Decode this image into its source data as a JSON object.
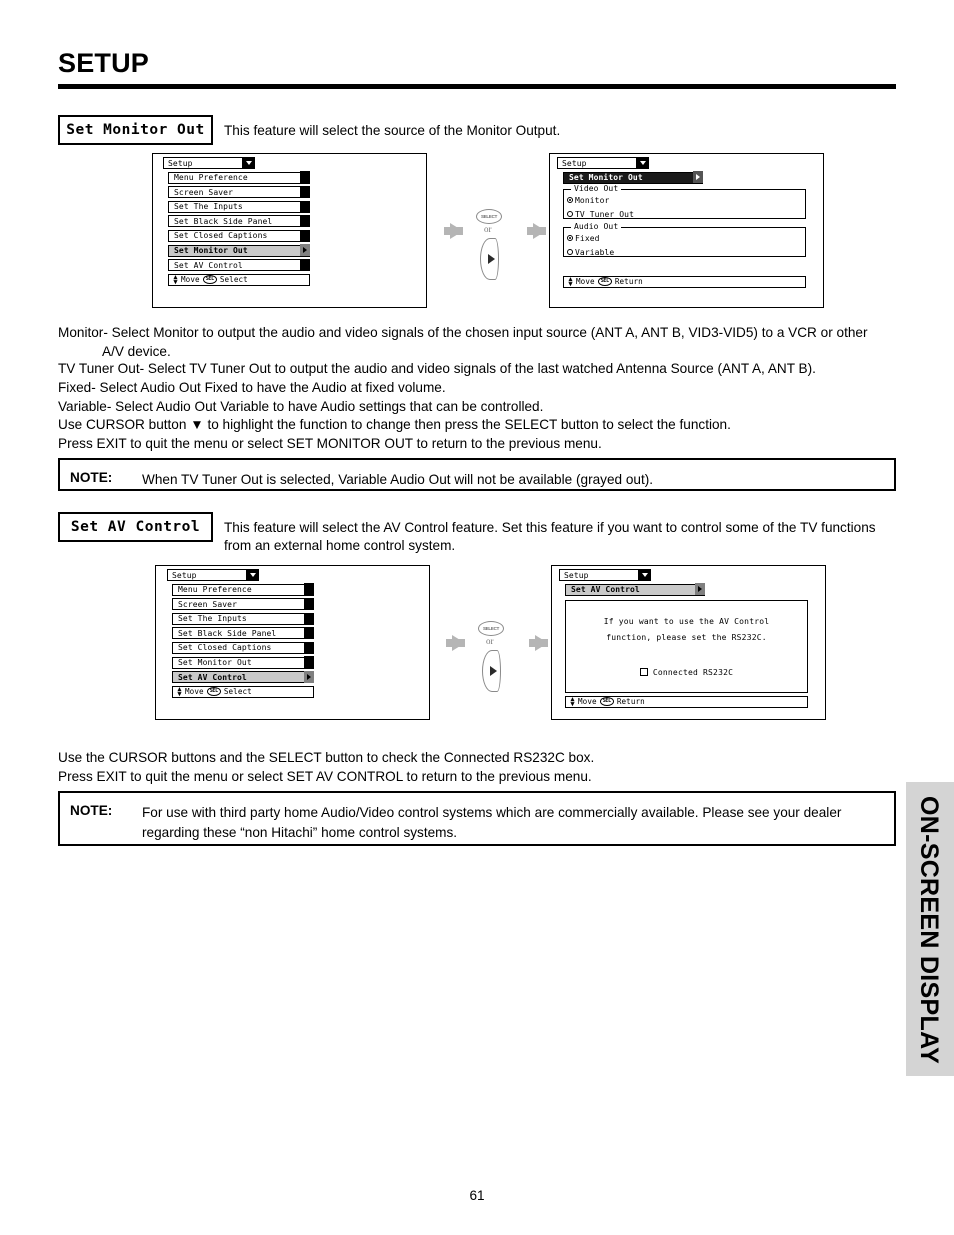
{
  "page": {
    "title": "SETUP",
    "number": "61",
    "side_tab": "ON-SCREEN DISPLAY"
  },
  "sections": [
    {
      "chip": "Set Monitor Out",
      "description": "This feature will select the source of the Monitor Output.",
      "left_menu": {
        "header": "Setup",
        "items": [
          "Menu Preference",
          "Screen Saver",
          "Set The Inputs",
          "Set Black Side Panel",
          "Set Closed Captions",
          "Set Monitor Out",
          "Set AV Control"
        ],
        "selected_index": 5,
        "footer_move": "Move",
        "footer_badge": "SEL",
        "footer_action": "Select"
      },
      "right_menu": {
        "header": "Setup",
        "title_bar": "Set Monitor Out",
        "groups": [
          {
            "legend": "Video Out",
            "options": [
              {
                "label": "Monitor",
                "selected": true
              },
              {
                "label": "TV Tuner Out",
                "selected": false
              }
            ]
          },
          {
            "legend": "Audio Out",
            "options": [
              {
                "label": "Fixed",
                "selected": true
              },
              {
                "label": "Variable",
                "selected": false
              }
            ]
          }
        ],
        "footer_move": "Move",
        "footer_badge": "SEL",
        "footer_action": "Return"
      }
    },
    {
      "chip": "Set AV Control",
      "description": "This feature will select the AV Control feature.  Set this feature if you want to control some of the TV functions from an external home control system.",
      "left_menu": {
        "header": "Setup",
        "items": [
          "Menu Preference",
          "Screen Saver",
          "Set The Inputs",
          "Set Black Side Panel",
          "Set Closed Captions",
          "Set Monitor Out",
          "Set AV Control"
        ],
        "selected_index": 6,
        "footer_move": "Move",
        "footer_badge": "SEL",
        "footer_action": "Select"
      },
      "right_menu": {
        "header": "Setup",
        "title_bar": "Set AV Control",
        "message_line1": "If you want to use the AV Control",
        "message_line2": "function, please set the RS232C.",
        "checkbox_label": "Connected RS232C",
        "checkbox_checked": false,
        "footer_move": "Move",
        "footer_badge": "SEL",
        "footer_action": "Return"
      }
    }
  ],
  "flow": {
    "select_key_label": "SELECT",
    "or_label": "or"
  },
  "body_text": {
    "monitor_line": "Monitor- Select Monitor to output the audio and video signals of the chosen input source (ANT A, ANT B, VID3-VID5) to a VCR or other",
    "monitor_line_cont": "A/V device.",
    "tv_tuner_line": "TV Tuner Out- Select TV Tuner Out to output the audio and video signals of the last watched Antenna Source (ANT A, ANT B).",
    "fixed_line": "Fixed-  Select Audio Out Fixed to have the Audio at fixed volume.",
    "variable_line": "Variable- Select Audio Out Variable to have Audio settings that can be controlled.",
    "cursor_line": "Use CURSOR button ▼ to highlight the function to change then press the SELECT button to select the function.",
    "exit_line": "Press EXIT to quit the menu or select SET MONITOR OUT to return to the previous menu.",
    "av_cursor_line": "Use the CURSOR buttons and the SELECT button to check the Connected RS232C box.",
    "av_exit_line": "Press EXIT to quit the menu or select SET AV CONTROL to return to the previous menu."
  },
  "notes": [
    {
      "label": "NOTE:",
      "text": "When TV Tuner Out is selected, Variable Audio Out will not be available (grayed out)."
    },
    {
      "label": "NOTE:",
      "line1": "For use with third party home Audio/Video control systems which are commercially available.  Please see your dealer",
      "line2": "regarding these “non Hitachi” home control systems."
    }
  ]
}
